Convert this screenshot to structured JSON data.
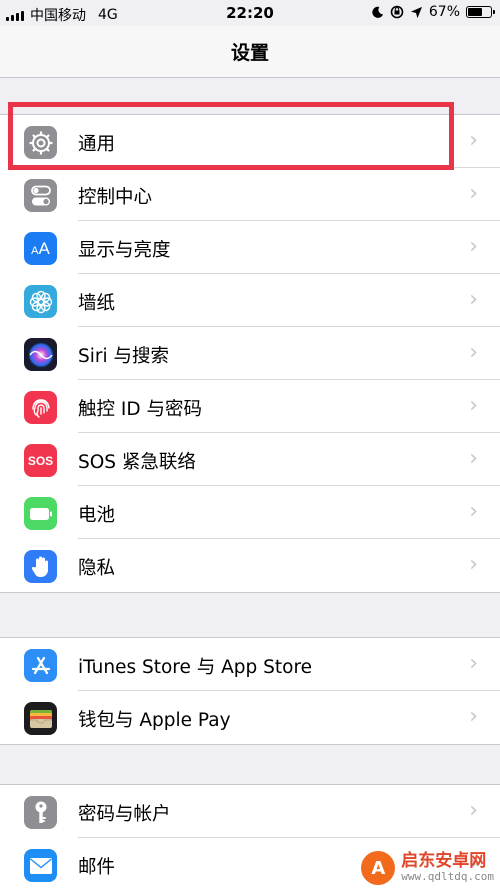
{
  "status_bar": {
    "carrier": "中国移动",
    "network": "4G",
    "time": "22:20",
    "battery_percent": "67%",
    "battery_level": 0.67,
    "icons": [
      "moon-icon",
      "rotation-lock-icon",
      "location-icon"
    ]
  },
  "nav": {
    "title": "设置"
  },
  "groups": [
    {
      "items": [
        {
          "label": "通用",
          "icon": "gear-icon",
          "color": "#8e8e93",
          "highlighted": true
        },
        {
          "label": "控制中心",
          "icon": "toggles-icon",
          "color": "#8e8e93"
        },
        {
          "label": "显示与亮度",
          "icon": "text-size-icon",
          "color": "#1c7cf4"
        },
        {
          "label": "墙纸",
          "icon": "flower-icon",
          "color": "#35aadc"
        },
        {
          "label": "Siri 与搜索",
          "icon": "siri-icon",
          "color": "#1a1a2e"
        },
        {
          "label": "触控 ID 与密码",
          "icon": "fingerprint-icon",
          "color": "#f2354e"
        },
        {
          "label": "SOS 紧急联络",
          "icon": "sos-icon",
          "color": "#f2354e"
        },
        {
          "label": "电池",
          "icon": "battery-icon",
          "color": "#4cd964"
        },
        {
          "label": "隐私",
          "icon": "hand-icon",
          "color": "#2f7cf6"
        }
      ]
    },
    {
      "items": [
        {
          "label": "iTunes Store 与 App Store",
          "icon": "app-store-icon",
          "color": "#2d8ff6"
        },
        {
          "label": "钱包与 Apple Pay",
          "icon": "wallet-icon",
          "color": "#1c1c1e"
        }
      ]
    },
    {
      "items": [
        {
          "label": "密码与帐户",
          "icon": "key-icon",
          "color": "#8e8e93"
        },
        {
          "label": "邮件",
          "icon": "mail-icon",
          "color": "#1e8ef5"
        }
      ]
    }
  ],
  "chevron": "›",
  "watermark": {
    "name": "启东安卓网",
    "url": "www.qdltdq.com",
    "logo_letter": "A"
  }
}
